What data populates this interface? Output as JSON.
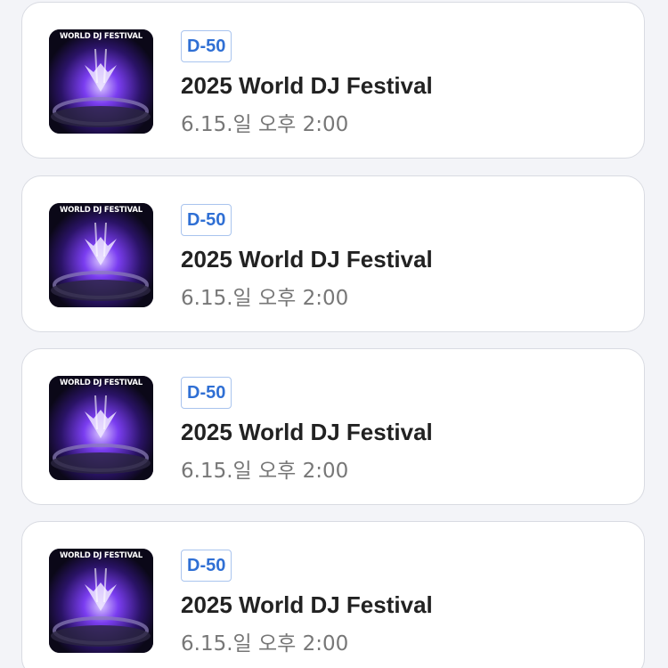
{
  "events": [
    {
      "poster_text": "WORLD DJ FESTIVAL",
      "badge": "D-50",
      "title": "2025 World DJ Festival",
      "date": "6.15.일 오후 2:00"
    },
    {
      "poster_text": "WORLD DJ FESTIVAL",
      "badge": "D-50",
      "title": "2025 World DJ Festival",
      "date": "6.15.일 오후 2:00"
    },
    {
      "poster_text": "WORLD DJ FESTIVAL",
      "badge": "D-50",
      "title": "2025 World DJ Festival",
      "date": "6.15.일 오후 2:00"
    },
    {
      "poster_text": "WORLD DJ FESTIVAL",
      "badge": "D-50",
      "title": "2025 World DJ Festival",
      "date": "6.15.일 오후 2:00"
    }
  ],
  "colors": {
    "badge_text": "#2f6fd4",
    "badge_border": "#a9c4ee",
    "title": "#222222",
    "date": "#777777",
    "background": "#f3f4f8"
  }
}
